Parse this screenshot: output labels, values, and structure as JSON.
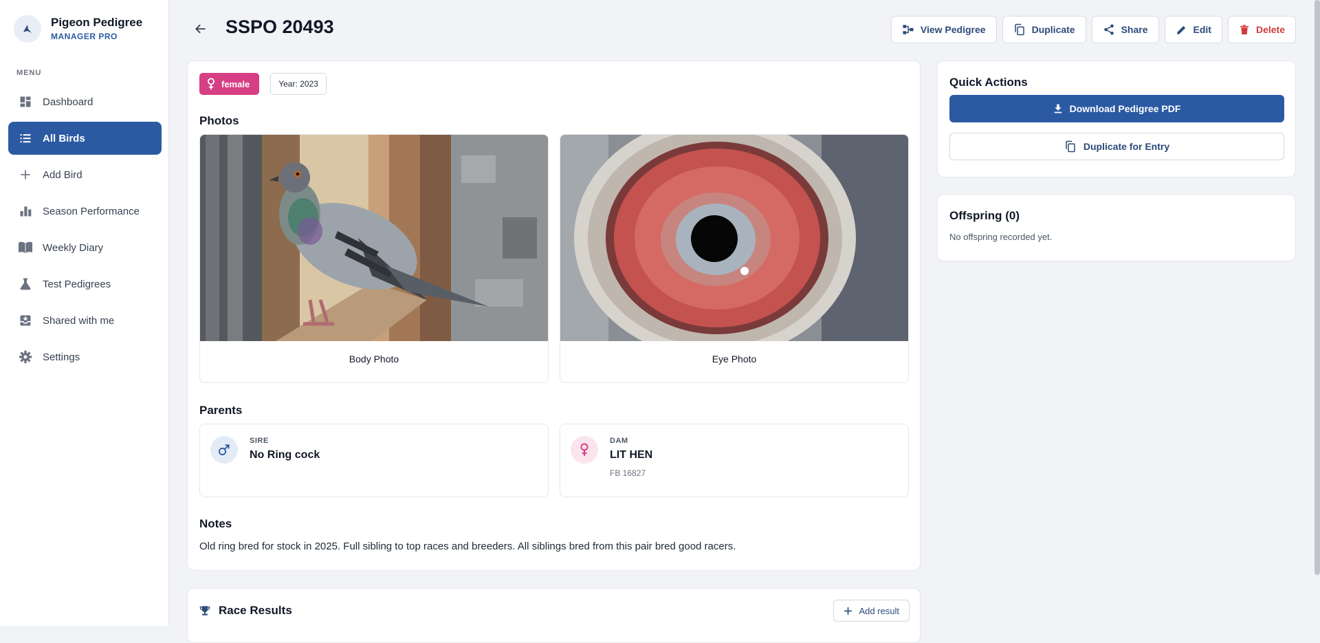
{
  "brand": {
    "name": "Pigeon Pedigree",
    "subtitle": "MANAGER PRO",
    "logo_icon": "bird-icon"
  },
  "sidebar": {
    "menu_label": "MENU",
    "items": [
      {
        "label": "Dashboard",
        "icon": "dashboard-icon",
        "active": false
      },
      {
        "label": "All Birds",
        "icon": "list-icon",
        "active": true
      },
      {
        "label": "Add Bird",
        "icon": "plus-icon",
        "active": false
      },
      {
        "label": "Season Performance",
        "icon": "bar-chart-icon",
        "active": false
      },
      {
        "label": "Weekly Diary",
        "icon": "book-icon",
        "active": false
      },
      {
        "label": "Test Pedigrees",
        "icon": "flask-icon",
        "active": false
      },
      {
        "label": "Shared with me",
        "icon": "inbox-icon",
        "active": false
      },
      {
        "label": "Settings",
        "icon": "gear-icon",
        "active": false
      }
    ]
  },
  "header": {
    "title": "SSPO 20493",
    "actions": {
      "view_pedigree": "View Pedigree",
      "duplicate": "Duplicate",
      "share": "Share",
      "edit": "Edit",
      "delete": "Delete"
    }
  },
  "bird": {
    "sex": "female",
    "year_label": "Year: 2023",
    "photos_title": "Photos",
    "photos": [
      {
        "caption": "Body Photo"
      },
      {
        "caption": "Eye Photo"
      }
    ],
    "parents_title": "Parents",
    "sire": {
      "role": "SIRE",
      "name": "No Ring cock",
      "ring": ""
    },
    "dam": {
      "role": "DAM",
      "name": "LIT HEN",
      "ring": "FB 16827"
    },
    "notes_title": "Notes",
    "notes": "Old ring bred for stock in 2025. Full sibling to top races and breeders. All siblings bred from this pair bred good racers."
  },
  "quick_actions": {
    "title": "Quick Actions",
    "download_pdf": "Download Pedigree PDF",
    "duplicate_entry": "Duplicate for Entry"
  },
  "offspring": {
    "title": "Offspring (0)",
    "empty_text": "No offspring recorded yet."
  },
  "race_results": {
    "title": "Race Results",
    "add_result": "Add result"
  },
  "colors": {
    "primary": "#2b5aa3",
    "female": "#d63f84",
    "danger": "#d03b3b",
    "background": "#f1f3f6"
  }
}
